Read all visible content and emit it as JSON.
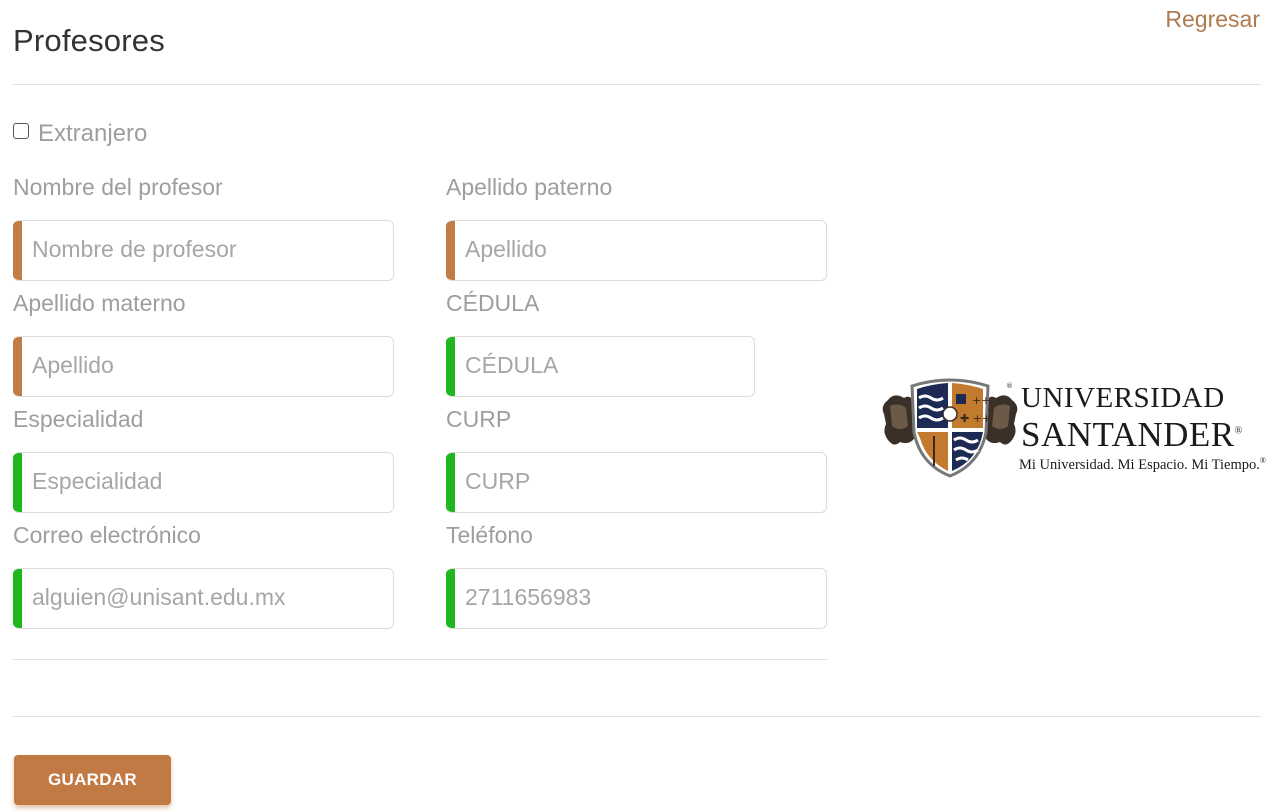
{
  "header": {
    "title": "Profesores",
    "back_label": "Regresar"
  },
  "form": {
    "foreign_label": "Extranjero",
    "foreign_checked": false,
    "fields": {
      "nombre": {
        "label": "Nombre del profesor",
        "placeholder": "Nombre de profesor",
        "status": "required"
      },
      "paterno": {
        "label": "Apellido paterno",
        "placeholder": "Apellido",
        "status": "required"
      },
      "materno": {
        "label": "Apellido materno",
        "placeholder": "Apellido",
        "status": "required"
      },
      "cedula": {
        "label": "CÉDULA",
        "placeholder": "CÉDULA",
        "status": "valid"
      },
      "especialidad": {
        "label": "Especialidad",
        "placeholder": "Especialidad",
        "status": "valid"
      },
      "curp": {
        "label": "CURP",
        "placeholder": "CURP",
        "status": "valid"
      },
      "correo": {
        "label": "Correo electrónico",
        "placeholder": "alguien@unisant.edu.mx",
        "status": "valid"
      },
      "telefono": {
        "label": "Teléfono",
        "placeholder": "2711656983",
        "status": "valid"
      }
    },
    "status_colors": {
      "required": "#c17d45",
      "valid": "#1eb71e"
    }
  },
  "logo": {
    "line1": "UNIVERSIDAD",
    "line2": "SANTANDER",
    "tagline": "Mi Universidad. Mi Espacio. Mi Tiempo.",
    "registered_mark": "®"
  },
  "actions": {
    "save_label": "GUARDAR"
  },
  "colors": {
    "accent": "#c17a43",
    "link": "#b07a4e",
    "text_muted": "#9e9e9e"
  }
}
